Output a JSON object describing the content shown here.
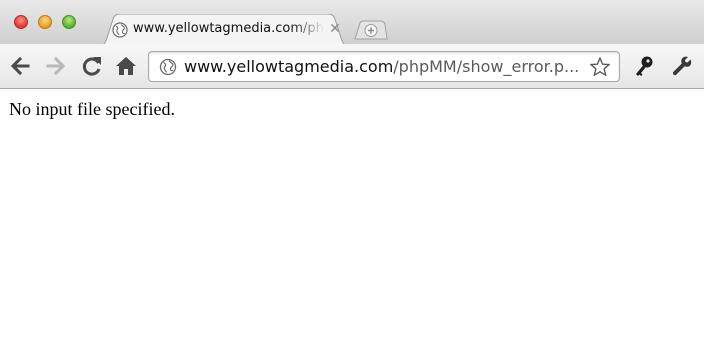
{
  "window": {
    "controls": [
      "close",
      "minimize",
      "maximize"
    ]
  },
  "tab": {
    "title": "www.yellowtagmedia.com/phpMM/show_error.php",
    "close_glyph": "✕",
    "favicon_icon": "globe-icon"
  },
  "new_tab": {
    "icon": "plus-icon"
  },
  "toolbar": {
    "back_icon": "back-arrow-icon",
    "forward_icon": "forward-arrow-icon",
    "reload_icon": "reload-icon",
    "home_icon": "home-icon",
    "page_action_icon": "key-icon",
    "wrench_icon": "wrench-icon"
  },
  "omnibox": {
    "host": "www.yellowtagmedia.com",
    "path": "/phpMM/show_error.p...",
    "globe_icon": "globe-icon",
    "star_icon": "star-icon"
  },
  "page": {
    "message": "No input file specified."
  },
  "colors": {
    "tabstrip": "#d8d8d8",
    "toolbar": "#eeeeee",
    "page_background": "#ffffff",
    "text": "#000000"
  }
}
